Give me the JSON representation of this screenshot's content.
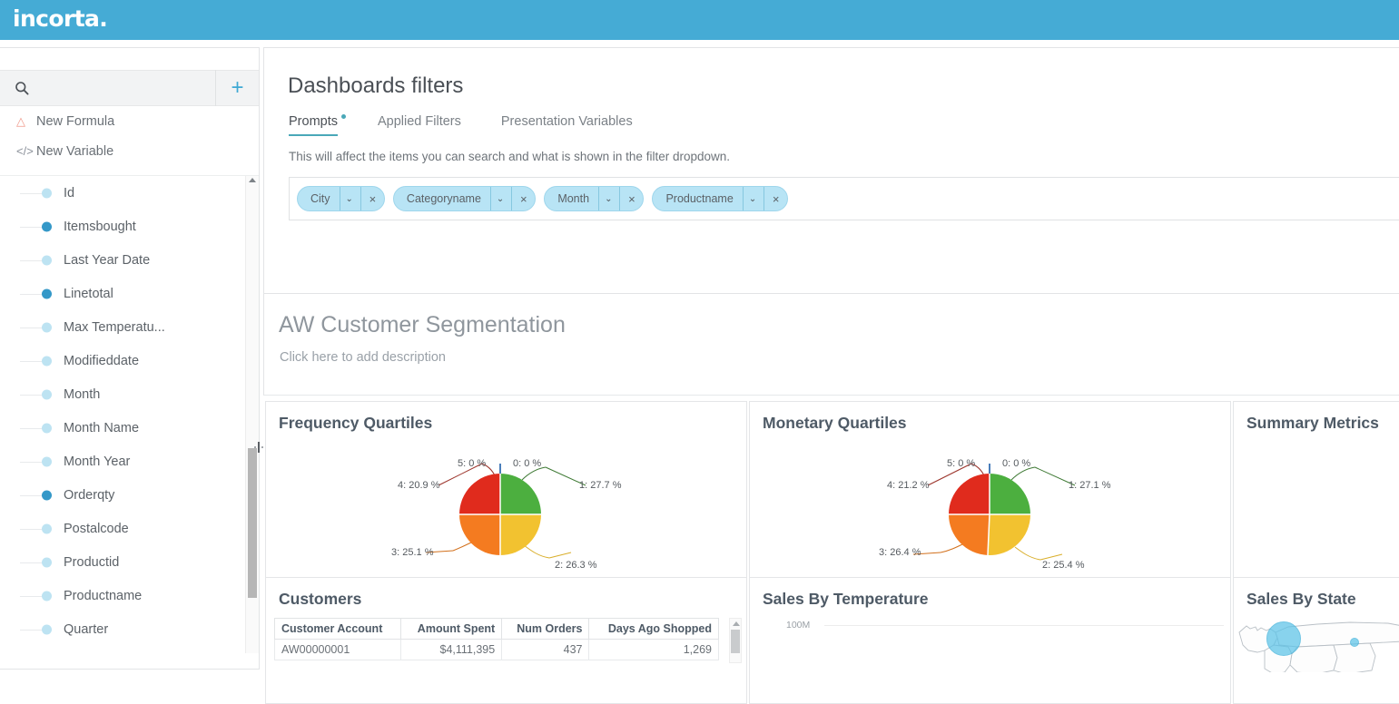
{
  "app": {
    "logo_text": "incorta.",
    "brand_color": "#45abd5"
  },
  "sidebar": {
    "search_placeholder": "",
    "add_label": "+",
    "actions": [
      {
        "label": "New Formula",
        "icon": "flask-icon"
      },
      {
        "label": "New Variable",
        "icon": "code-icon"
      }
    ],
    "fields": [
      {
        "label": "Id",
        "type": "attribute"
      },
      {
        "label": "Itemsbought",
        "type": "measure"
      },
      {
        "label": "Last Year Date",
        "type": "attribute"
      },
      {
        "label": "Linetotal",
        "type": "measure"
      },
      {
        "label": "Max Temperatu...",
        "type": "attribute"
      },
      {
        "label": "Modifieddate",
        "type": "attribute"
      },
      {
        "label": "Month",
        "type": "attribute"
      },
      {
        "label": "Month Name",
        "type": "attribute"
      },
      {
        "label": "Month Year",
        "type": "attribute"
      },
      {
        "label": "Orderqty",
        "type": "measure"
      },
      {
        "label": "Postalcode",
        "type": "attribute"
      },
      {
        "label": "Productid",
        "type": "attribute"
      },
      {
        "label": "Productname",
        "type": "attribute"
      },
      {
        "label": "Quarter",
        "type": "attribute"
      }
    ]
  },
  "filters": {
    "title": "Dashboards filters",
    "tabs": [
      {
        "label": "Prompts",
        "active": true,
        "badge": true
      },
      {
        "label": "Applied Filters",
        "active": false,
        "badge": false
      },
      {
        "label": "Presentation Variables",
        "active": false,
        "badge": false
      }
    ],
    "hint": "This will affect the items you can search and what is shown in the filter dropdown.",
    "pills": [
      {
        "label": "City",
        "chevron": "⌄",
        "close": "×"
      },
      {
        "label": "Categoryname",
        "chevron": "⌄",
        "close": "×"
      },
      {
        "label": "Month",
        "chevron": "⌄",
        "close": "×"
      },
      {
        "label": "Productname",
        "chevron": "⌄",
        "close": "×"
      }
    ]
  },
  "dashboard": {
    "title": "AW Customer Segmentation",
    "description": "Click here to add description"
  },
  "widgets": {
    "frequency": {
      "title": "Frequency Quartiles"
    },
    "monetary": {
      "title": "Monetary Quartiles"
    },
    "summary": {
      "title": "Summary Metrics"
    },
    "customers": {
      "title": "Customers"
    },
    "temperature": {
      "title": "Sales By Temperature"
    },
    "state": {
      "title": "Sales By State"
    }
  },
  "customers_table": {
    "columns": [
      "Customer Account",
      "Amount Spent",
      "Num Orders",
      "Days Ago Shopped"
    ],
    "rows": [
      [
        "AW00000001",
        "$4,111,395",
        "437",
        "1,269"
      ]
    ]
  },
  "chart_data": [
    {
      "type": "pie",
      "title": "Frequency Quartiles",
      "categories": [
        "0",
        "1",
        "2",
        "3",
        "4",
        "5"
      ],
      "values": [
        0,
        27.7,
        26.3,
        25.1,
        20.9,
        0
      ],
      "labels": [
        "0: 0 %",
        "1: 27.7 %",
        "2: 26.3 %",
        "3: 25.1 %",
        "4: 20.9 %",
        "5: 0 %"
      ],
      "colors": [
        "#4a7ebb",
        "#4caf3f",
        "#f2c230",
        "#f47b20",
        "#e02b1d",
        "#4a7ebb"
      ],
      "unit": "%",
      "legend": "none"
    },
    {
      "type": "pie",
      "title": "Monetary Quartiles",
      "categories": [
        "0",
        "1",
        "2",
        "3",
        "4",
        "5"
      ],
      "values": [
        0,
        27.1,
        25.4,
        26.4,
        21.2,
        0
      ],
      "labels": [
        "0: 0 %",
        "1: 27.1 %",
        "2: 25.4 %",
        "3: 26.4 %",
        "4: 21.2 %",
        "5: 0 %"
      ],
      "colors": [
        "#4a7ebb",
        "#4caf3f",
        "#f2c230",
        "#f47b20",
        "#e02b1d",
        "#4a7ebb"
      ],
      "unit": "%",
      "legend": "none"
    },
    {
      "type": "bar",
      "title": "Sales By Temperature",
      "categories": [],
      "values": [],
      "ylabel": "",
      "yticks": [
        "100M"
      ],
      "grid": true
    },
    {
      "type": "scatter",
      "title": "Sales By State",
      "map": "united-states",
      "points": [
        {
          "state": "Washington",
          "size": "large"
        },
        {
          "state": "Montana",
          "size": "small"
        }
      ]
    }
  ]
}
